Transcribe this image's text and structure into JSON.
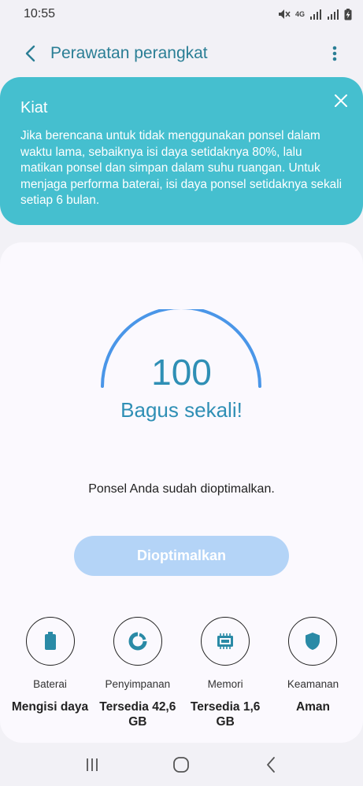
{
  "status_bar": {
    "time": "10:55",
    "network_label": "4G",
    "icons": [
      "mute-icon",
      "signal-icon",
      "signal-icon",
      "battery-charging-icon"
    ]
  },
  "app_bar": {
    "title": "Perawatan perangkat",
    "back_icon": "chevron-left-icon",
    "menu_icon": "more-vert-icon"
  },
  "tip": {
    "title": "Kiat",
    "body": "Jika berencana untuk tidak menggunakan ponsel dalam waktu lama, sebaiknya isi daya setidaknya 80%, lalu matikan ponsel dan simpan dalam suhu ruangan. Untuk menjaga performa baterai, isi daya ponsel setidaknya sekali setiap 6 bulan.",
    "close_icon": "close-icon",
    "background_color": "#45bfcf"
  },
  "score": {
    "value": "100",
    "label": "Bagus sekali!",
    "gauge_fraction": 1.0,
    "color": "#2f8fb5"
  },
  "message": "Ponsel Anda sudah dioptimalkan.",
  "optimize_button": {
    "label": "Dioptimalkan",
    "enabled": false,
    "color": "#b4d4f7"
  },
  "tiles": [
    {
      "icon": "battery-icon",
      "label": "Baterai",
      "value": "Mengisi daya"
    },
    {
      "icon": "storage-pie-icon",
      "label": "Penyimpanan",
      "value": "Tersedia 42,6 GB"
    },
    {
      "icon": "memory-chip-icon",
      "label": "Memori",
      "value": "Tersedia 1,6 GB"
    },
    {
      "icon": "shield-icon",
      "label": "Keamanan",
      "value": "Aman"
    }
  ],
  "nav_bar": {
    "icons": [
      "recent-apps-icon",
      "home-icon",
      "back-icon"
    ]
  }
}
